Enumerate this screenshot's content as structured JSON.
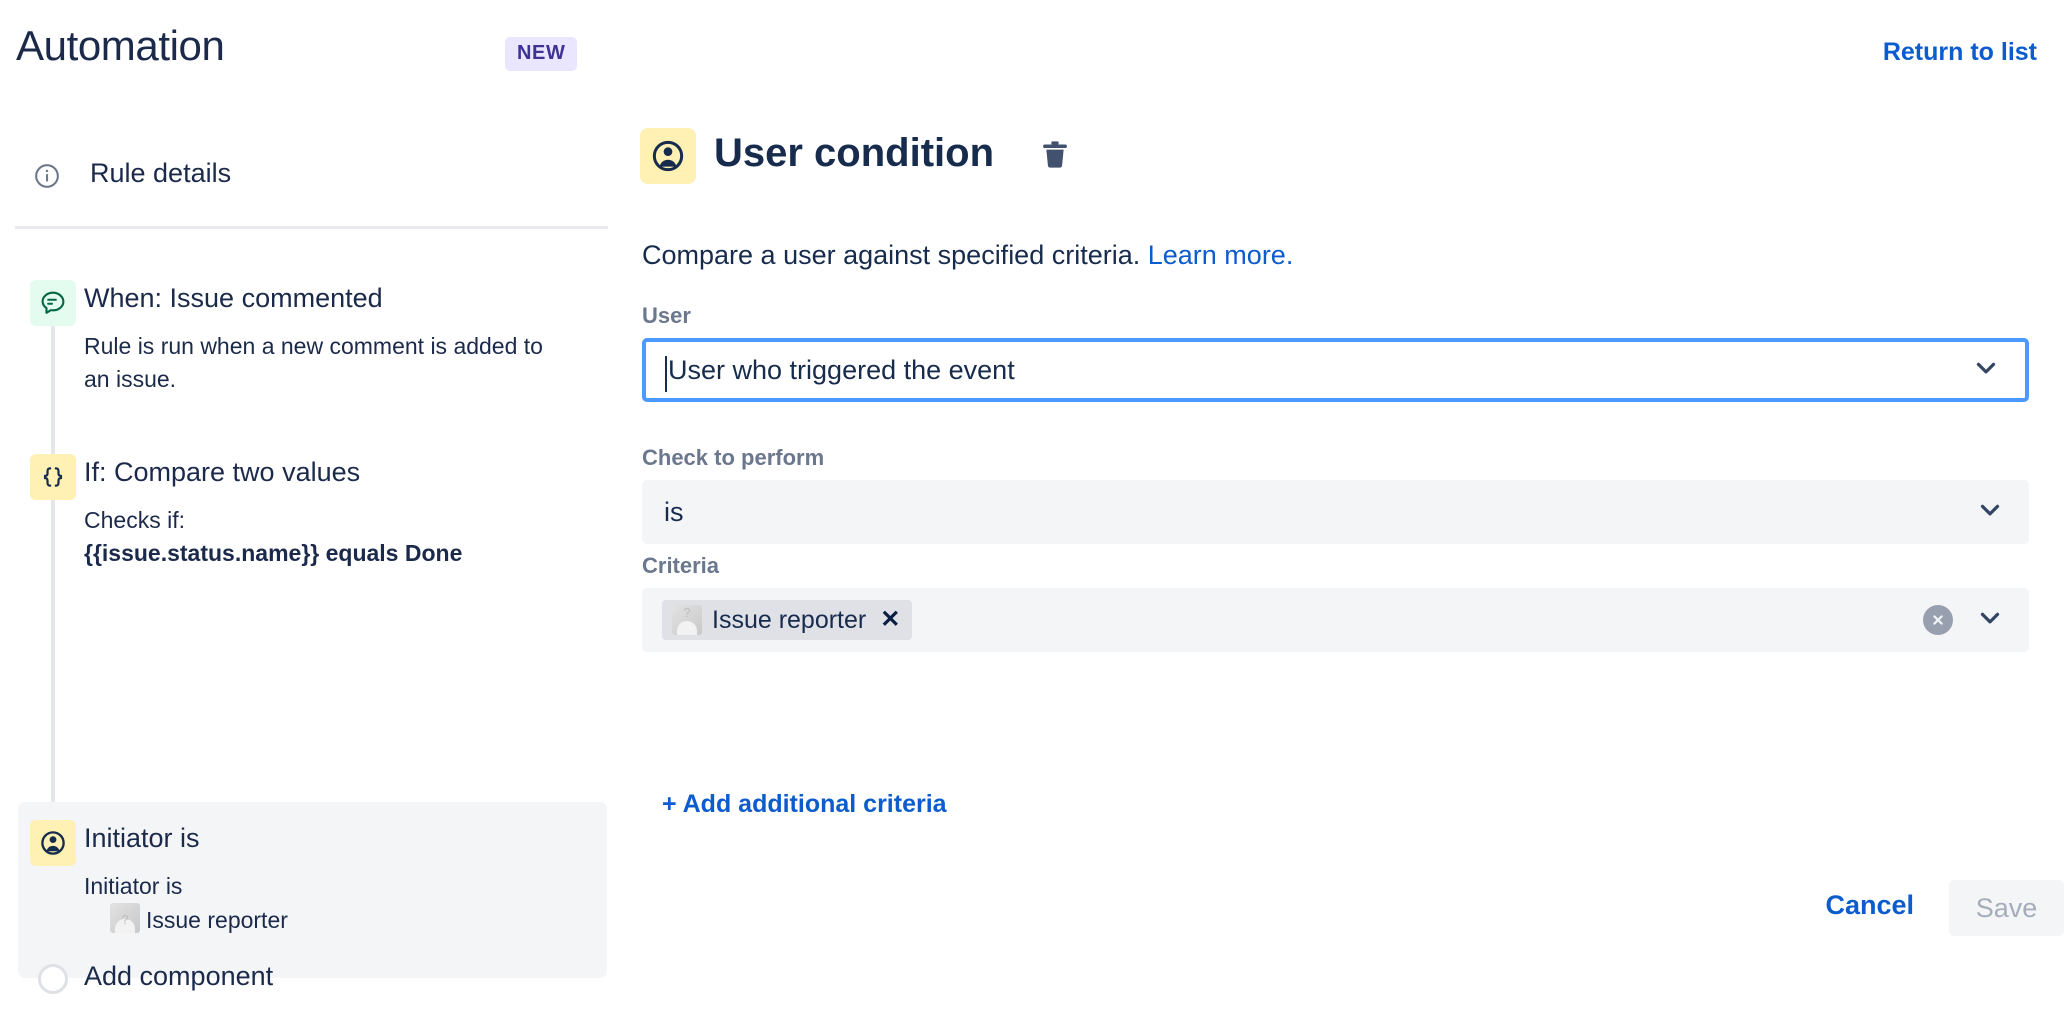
{
  "header": {
    "app_title": "Automation",
    "badge": "NEW",
    "return_link": "Return to list"
  },
  "sidebar": {
    "rule_details": {
      "label": "Rule details",
      "icon": "info-circle-icon"
    },
    "nodes": [
      {
        "title": "When: Issue commented",
        "description": "Rule is run when a new comment is added to an issue.",
        "icon": "comment-icon",
        "icon_style": "green",
        "selected": false
      },
      {
        "title": "If: Compare two values",
        "description_line1": "Checks if:",
        "description_line2": "{{issue.status.name}} equals Done",
        "icon": "curly-braces-icon",
        "icon_style": "yellow",
        "selected": false
      },
      {
        "title": "Initiator is",
        "description_line1": "Initiator is",
        "description_line2": "Issue reporter",
        "icon": "user-circle-icon",
        "icon_style": "yellow",
        "selected": true
      }
    ],
    "add_component": {
      "label": "Add component",
      "icon": "empty-circle-icon"
    }
  },
  "main": {
    "title": "User condition",
    "title_icon": "user-circle-icon",
    "delete_icon": "trash-icon",
    "description": "Compare a user against specified criteria.",
    "learn_more": "Learn more.",
    "fields": {
      "user": {
        "label": "User",
        "value": "User who triggered the event",
        "focused": true
      },
      "check_to_perform": {
        "label": "Check to perform",
        "value": "is",
        "focused": false
      },
      "criteria": {
        "label": "Criteria",
        "chip_label": "Issue reporter",
        "chip_remove": "✕",
        "add_link": "+ Add additional criteria"
      }
    },
    "footer": {
      "cancel_label": "Cancel",
      "save_label": "Save"
    }
  },
  "colors": {
    "link_blue": "#0c5cce",
    "focus_blue": "#4C9AFF",
    "text_dark": "#172B4D",
    "label_gray": "#6B778C",
    "field_bg": "#F4F5F7",
    "icon_yellow": "#FFF0B3",
    "icon_green": "#E3FCEF",
    "badge_bg": "#EAE6FF",
    "badge_text": "#403294"
  }
}
